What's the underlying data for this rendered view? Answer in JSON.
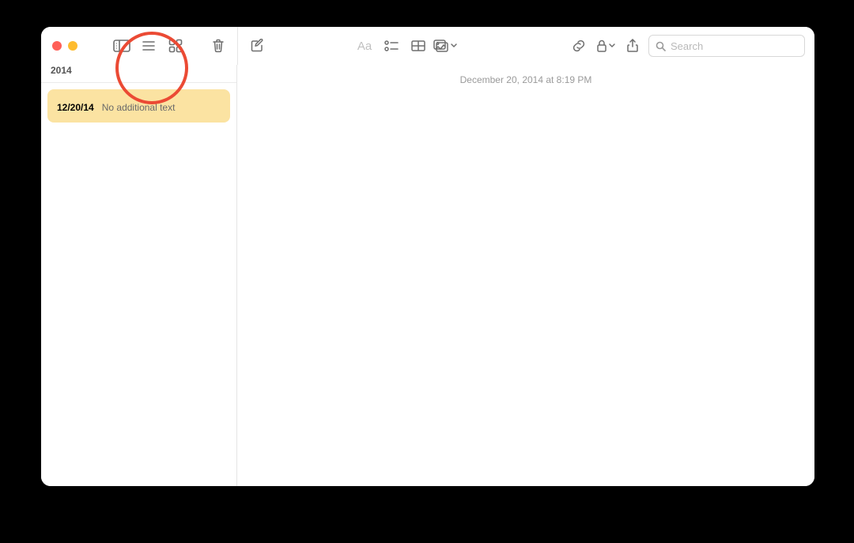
{
  "toolbar": {
    "search_placeholder": "Search"
  },
  "sidebar": {
    "section_header": "2014",
    "items": [
      {
        "title_icon": "",
        "date": "12/20/14",
        "preview": "No additional text"
      }
    ]
  },
  "editor": {
    "timestamp": "December 20, 2014 at 8:19 PM",
    "content_icon": ""
  }
}
